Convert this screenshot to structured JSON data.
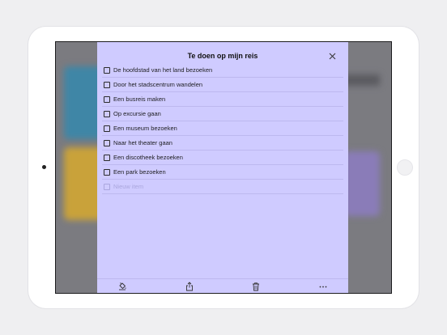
{
  "list": {
    "title": "Te doen op mijn reis",
    "items": [
      {
        "label": "De hoofdstad van het land bezoeken",
        "checked": false
      },
      {
        "label": "Door het stadscentrum wandelen",
        "checked": false
      },
      {
        "label": "Een busreis maken",
        "checked": false
      },
      {
        "label": "Op excursie gaan",
        "checked": false
      },
      {
        "label": "Een museum bezoeken",
        "checked": false
      },
      {
        "label": "Naar het theater gaan",
        "checked": false
      },
      {
        "label": "Een discotheek bezoeken",
        "checked": false
      },
      {
        "label": "Een park bezoeken",
        "checked": false
      }
    ],
    "new_item_placeholder": "Nieuw item"
  },
  "toolbar": {
    "icons": [
      "paint-bucket-icon",
      "share-icon",
      "trash-icon",
      "more-icon"
    ]
  },
  "colors": {
    "panel_background": "#cfcbff",
    "divider": "#bdb8ef",
    "placeholder": "#aaa6dd"
  }
}
